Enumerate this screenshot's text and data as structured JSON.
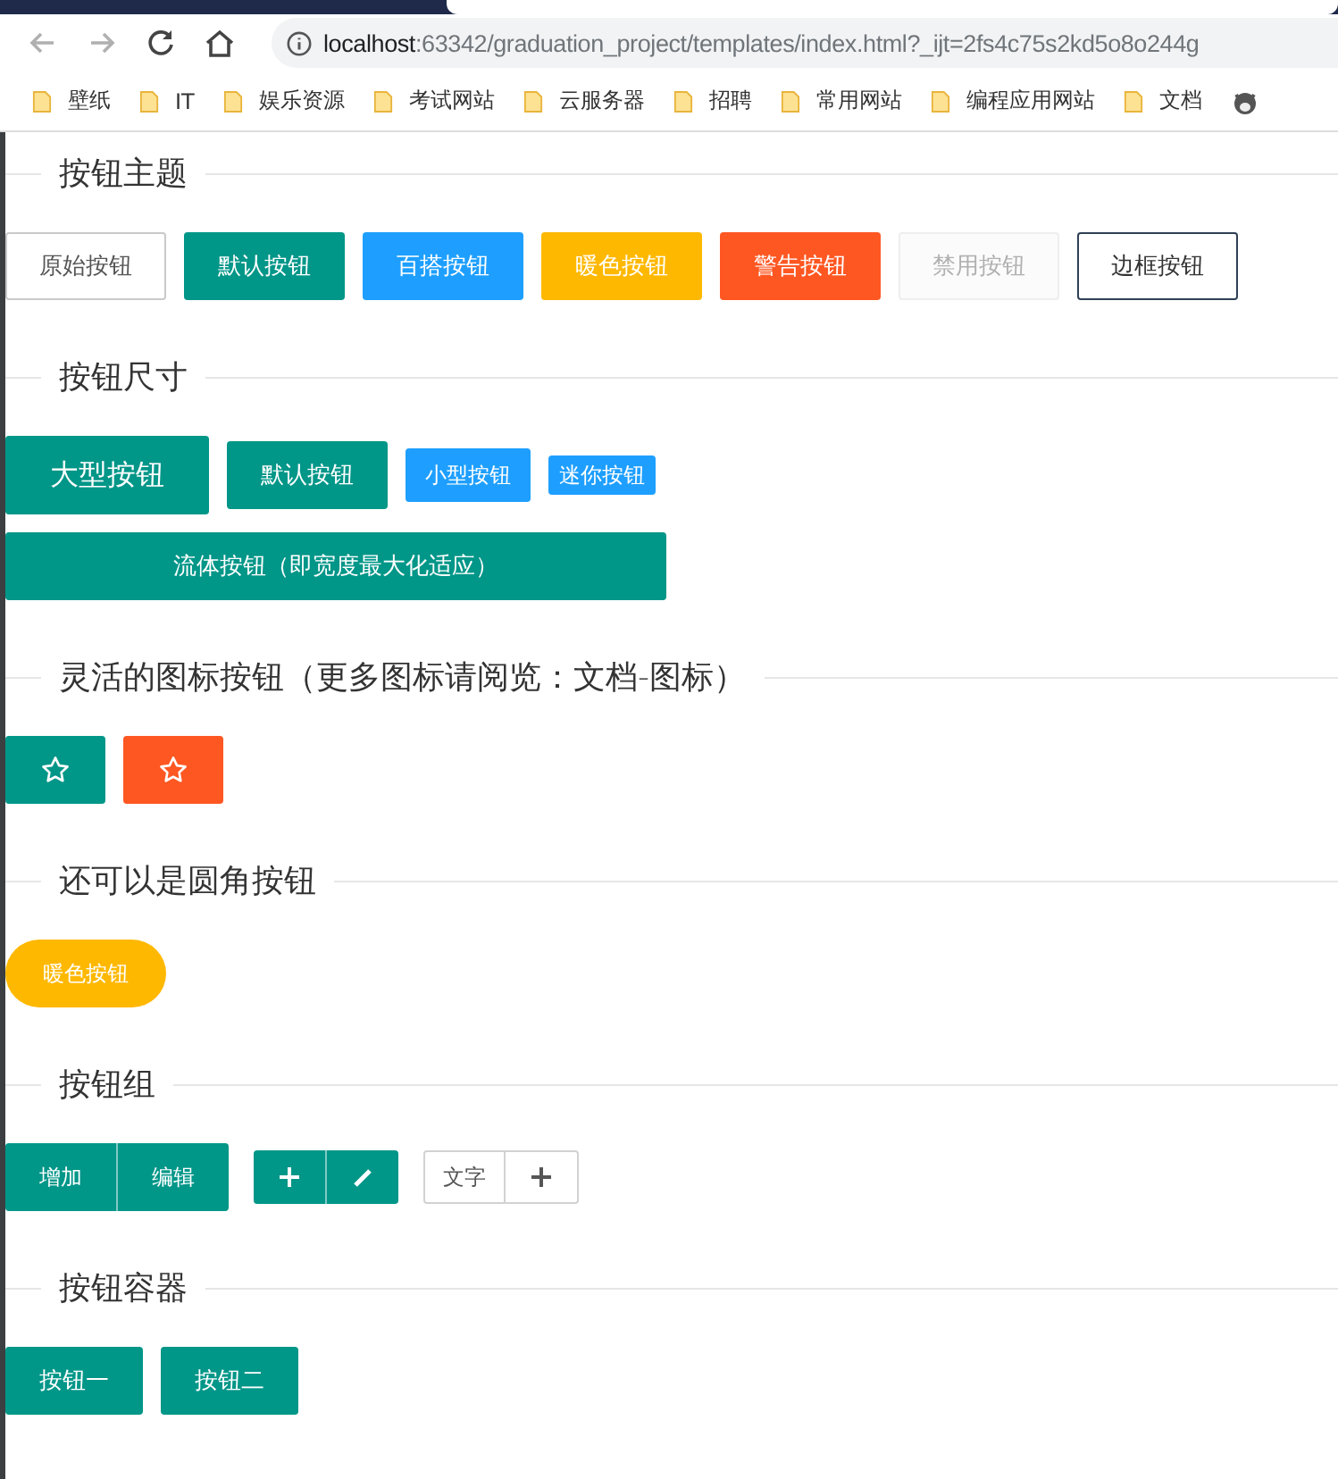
{
  "browser": {
    "url_host": "localhost",
    "url_rest": ":63342/graduation_project/templates/index.html?_ijt=2fs4c75s2kd5o8o244g",
    "bookmarks": [
      "壁纸",
      "IT",
      "娱乐资源",
      "考试网站",
      "云服务器",
      "招聘",
      "常用网站",
      "编程应用网站",
      "文档"
    ]
  },
  "sections": [
    {
      "title": "按钮主题",
      "rows": [
        {
          "items": [
            {
              "kind": "primary",
              "label": "原始按钮"
            },
            {
              "kind": "default",
              "label": "默认按钮"
            },
            {
              "kind": "normal",
              "label": "百搭按钮"
            },
            {
              "kind": "warm",
              "label": "暖色按钮"
            },
            {
              "kind": "danger",
              "label": "警告按钮"
            },
            {
              "kind": "disabled",
              "label": "禁用按钮"
            },
            {
              "kind": "border",
              "label": "边框按钮"
            }
          ]
        }
      ]
    },
    {
      "title": "按钮尺寸",
      "rows": [
        {
          "items": [
            {
              "kind": "large",
              "label": "大型按钮"
            },
            {
              "kind": "default",
              "label": "默认按钮"
            },
            {
              "kind": "small",
              "label": "小型按钮"
            },
            {
              "kind": "mini",
              "label": "迷你按钮"
            }
          ]
        },
        {
          "items": [
            {
              "kind": "fluid",
              "label": "流体按钮（即宽度最大化适应）"
            }
          ]
        }
      ]
    },
    {
      "title": "灵活的图标按钮（更多图标请阅览：文档-图标）",
      "rows": [
        {
          "items": [
            {
              "kind": "icon",
              "color": "#009688"
            },
            {
              "kind": "icon",
              "color": "#ff5722"
            }
          ]
        }
      ]
    },
    {
      "title": "还可以是圆角按钮",
      "rows": [
        {
          "items": [
            {
              "kind": "radius",
              "label": "暖色按钮"
            }
          ]
        }
      ]
    },
    {
      "title": "按钮组",
      "rows": [
        {
          "items": [
            {
              "kind": "group",
              "buttons": [
                {
                  "kind": "text",
                  "label": "增加"
                },
                {
                  "kind": "text",
                  "label": "编辑"
                }
              ]
            },
            {
              "kind": "smallgroup",
              "buttons": [
                {
                  "kind": "add"
                },
                {
                  "kind": "edit"
                }
              ]
            },
            {
              "kind": "plaingroup",
              "buttons": [
                {
                  "kind": "text",
                  "label": "文字"
                },
                {
                  "kind": "add"
                }
              ]
            }
          ]
        }
      ]
    },
    {
      "title": "按钮容器",
      "rows": [
        {
          "items": [
            {
              "kind": "default",
              "label": "按钮一"
            },
            {
              "kind": "default",
              "label": "按钮二"
            }
          ]
        }
      ]
    }
  ]
}
